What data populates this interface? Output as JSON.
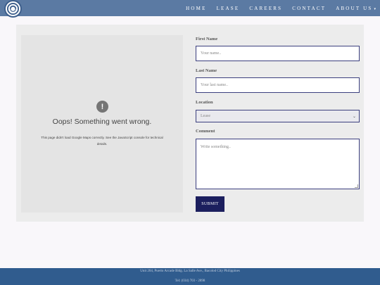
{
  "header": {
    "nav": [
      {
        "label": "HOME"
      },
      {
        "label": "LEASE"
      },
      {
        "label": "CAREERS"
      },
      {
        "label": "CONTACT"
      },
      {
        "label": "ABOUT US"
      }
    ],
    "about_caret": "▾"
  },
  "map": {
    "icon": "!",
    "title": "Oops! Something went wrong.",
    "detail": "This page didn't load Google Maps correctly. See the JavaScript console for technical details."
  },
  "form": {
    "first_name_label": "First Name",
    "first_name_placeholder": "Your name..",
    "last_name_label": "Last Name",
    "last_name_placeholder": "Your last name..",
    "location_label": "Location",
    "location_value": "Lease",
    "comment_label": "Comment",
    "comment_placeholder": "Write something..",
    "submit_label": "SUBMIT"
  },
  "footer": {
    "address": "Unit 204, Puerto Arcade Bldg. La Salle Ave., Bacolod City Philippines",
    "tel": "Tel: (034) 703 - 2898"
  },
  "colors": {
    "header_bg": "#5b7aa3",
    "footer_bg": "#305c8e",
    "submit_bg": "#1c1f5e"
  }
}
